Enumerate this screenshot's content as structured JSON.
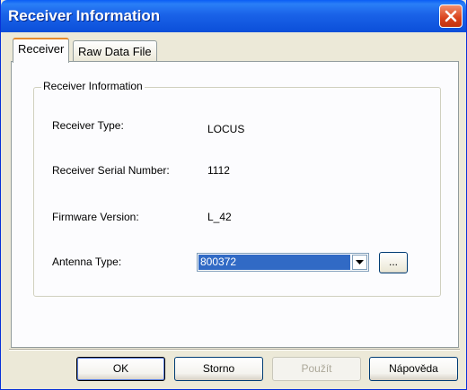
{
  "window": {
    "title": "Receiver Information"
  },
  "tabs": [
    {
      "label": "Receiver",
      "active": true
    },
    {
      "label": "Raw Data File",
      "active": false
    }
  ],
  "group": {
    "legend": "Receiver Information",
    "fields": {
      "receiver_type": {
        "label": "Receiver Type:",
        "value": "LOCUS"
      },
      "serial_number": {
        "label": "Receiver Serial Number:",
        "value": "1112"
      },
      "firmware_version": {
        "label": "Firmware Version:",
        "value": "L_42"
      },
      "antenna_type": {
        "label": "Antenna Type:",
        "value": "800372"
      }
    },
    "browse_label": "..."
  },
  "buttons": {
    "ok": "OK",
    "cancel": "Storno",
    "apply": "Použít",
    "help": "Nápověda"
  },
  "colors": {
    "titlebar": "#0b4fd9",
    "selection": "#316ac5",
    "face": "#ece9d8"
  },
  "icons": {
    "close": "close-icon",
    "dropdown": "chevron-down-icon"
  }
}
